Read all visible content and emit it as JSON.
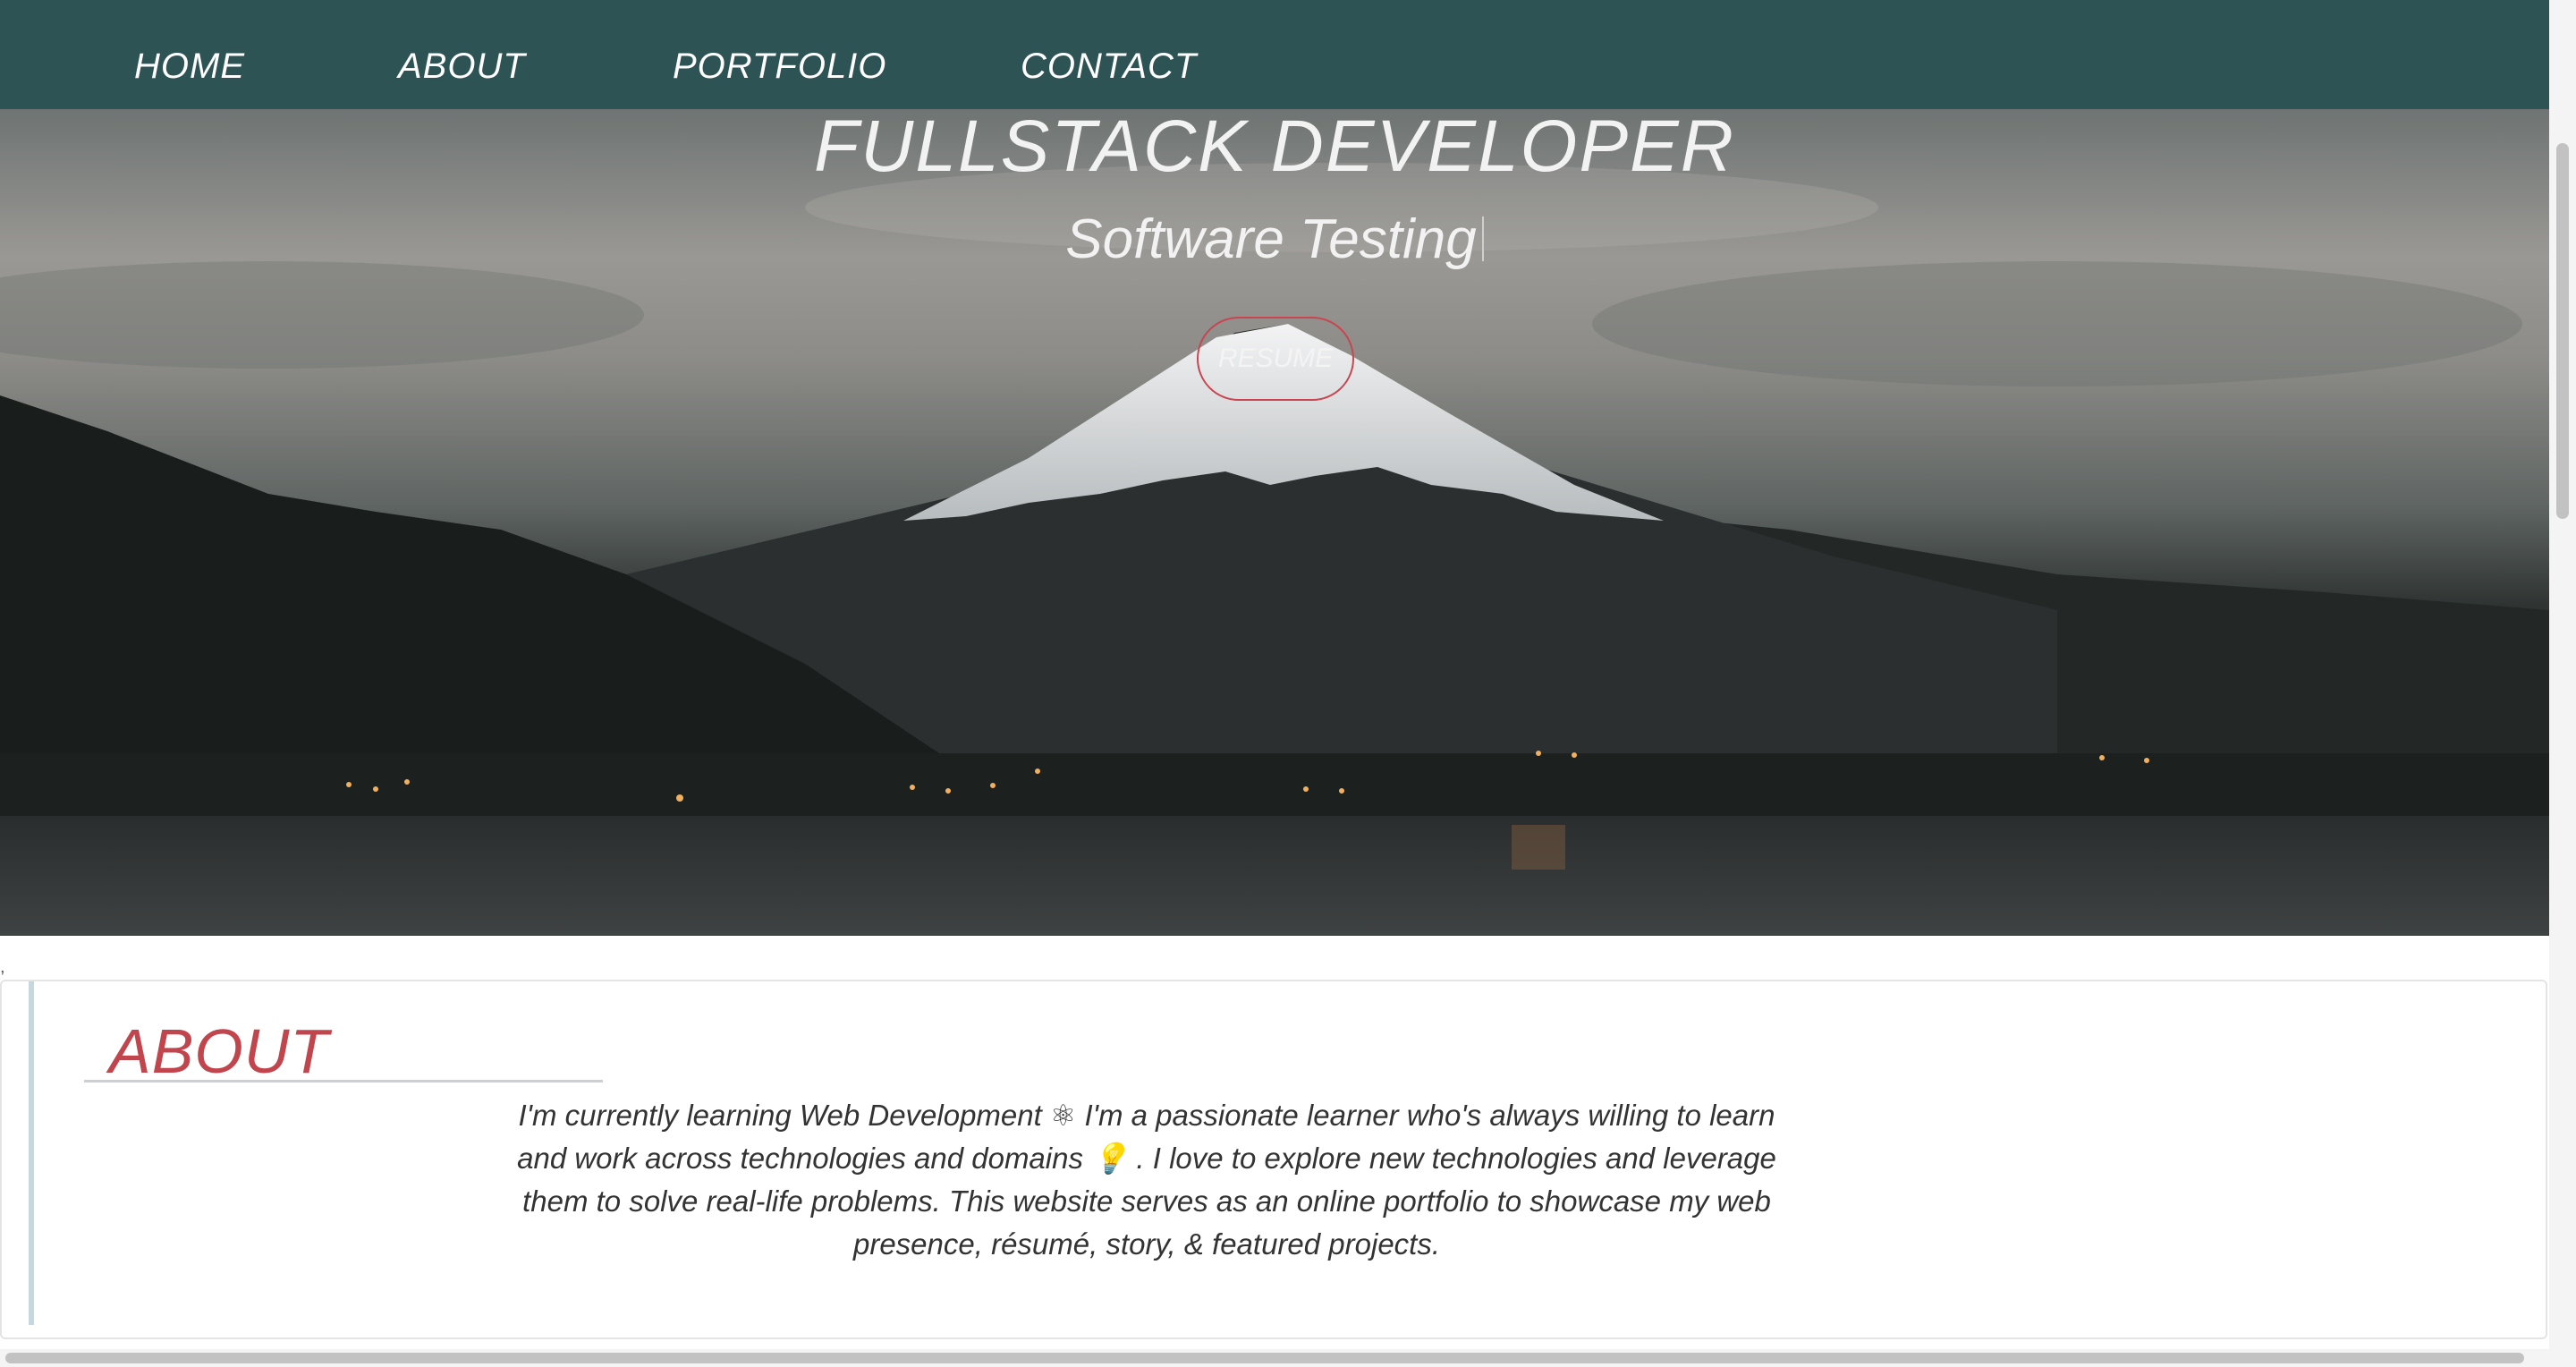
{
  "nav": {
    "items": [
      {
        "label": "HOME"
      },
      {
        "label": "ABOUT"
      },
      {
        "label": "PORTFOLIO"
      },
      {
        "label": "CONTACT"
      }
    ]
  },
  "hero": {
    "title": "FULLSTACK DEVELOPER",
    "subtitle": "Software Testing",
    "resume_label": "RESUME"
  },
  "about": {
    "heading": "ABOUT",
    "text": "I'm currently learning Web Development ⚛  I'm a passionate learner who's always willing to learn and work across technologies and domains 💡 . I love to explore new technologies and leverage them to solve real-life problems. This website serves as an online portfolio to showcase my web presence, résumé, story, & featured projects."
  },
  "colors": {
    "nav_bg": "#2e5354",
    "accent_red": "#c1454c",
    "resume_border": "#c9454f"
  }
}
